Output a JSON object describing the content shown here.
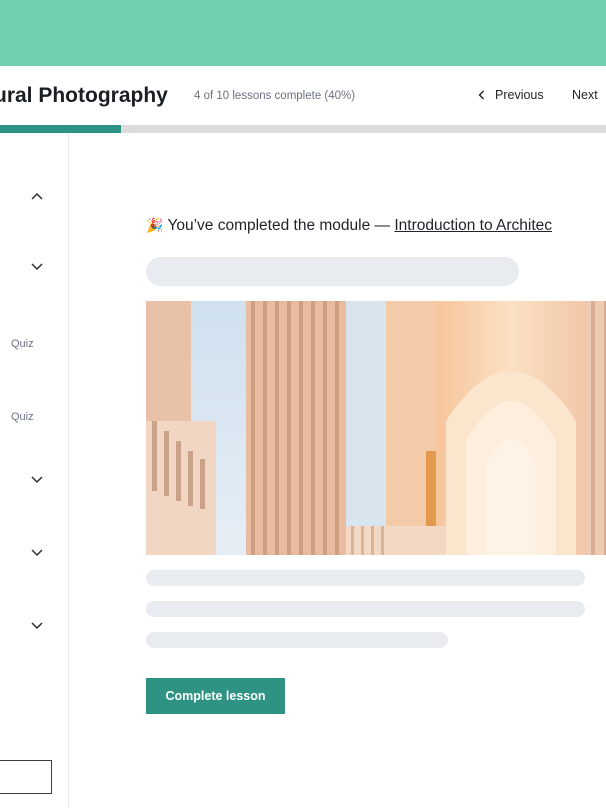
{
  "header": {
    "course_title": "ural Photography",
    "progress_text": "4 of 10 lessons complete (40%)",
    "progress_fraction": 0.2,
    "prev_label": "Previous",
    "next_label": "Next"
  },
  "sidebar": {
    "items": [
      {
        "icon": "chevron-up-icon"
      },
      {
        "icon": "chevron-down-icon"
      },
      {
        "label": "Quiz"
      },
      {
        "label": "Quiz"
      },
      {
        "icon": "chevron-down-icon"
      },
      {
        "icon": "chevron-down-icon"
      },
      {
        "icon": "chevron-down-icon"
      }
    ]
  },
  "main": {
    "completed_prefix": "You’ve completed the module —",
    "module_link": "Introduction to Architec",
    "complete_button": "Complete lesson"
  },
  "colors": {
    "topbar": "#70cfb1",
    "accent": "#2f9384",
    "skeleton": "#e8ecf1"
  }
}
